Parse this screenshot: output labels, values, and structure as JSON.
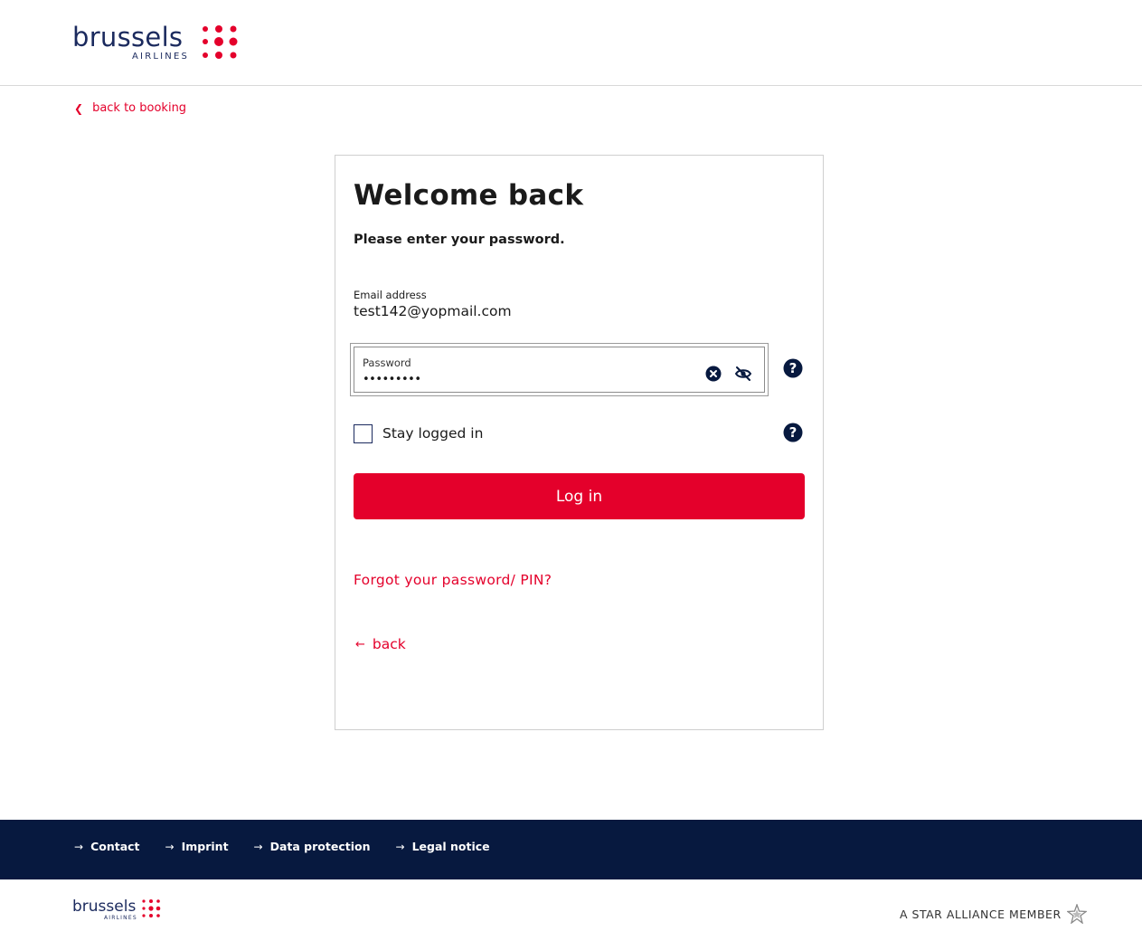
{
  "header": {
    "logo_text": "brussels",
    "logo_sub": "AIRLINES",
    "brand_color": "#1b2a5e",
    "accent_color": "#e4002b"
  },
  "nav": {
    "back_to_booking": "back to booking",
    "back_icon": "chevron-left-icon"
  },
  "login": {
    "title": "Welcome back",
    "subtitle": "Please enter your password.",
    "email_label": "Email address",
    "email_value": "test142@yopmail.com",
    "password_label": "Password",
    "password_value": "•••••••••",
    "clear_icon": "clear-circle-icon",
    "visibility_icon": "eye-off-icon",
    "help_icon": "question-circle-icon",
    "stay_logged_in": "Stay logged in",
    "stay_logged_in_checked": false,
    "login_button": "Log in",
    "forgot_link": "Forgot your password/ PIN?",
    "back_link": "back"
  },
  "footer": {
    "links": [
      "Contact",
      "Imprint",
      "Data protection",
      "Legal notice"
    ],
    "bar_color": "#07193f",
    "logo_text": "brussels",
    "logo_sub": "AIRLINES",
    "star_alliance": "A STAR ALLIANCE MEMBER",
    "star_icon": "star-alliance-icon"
  }
}
